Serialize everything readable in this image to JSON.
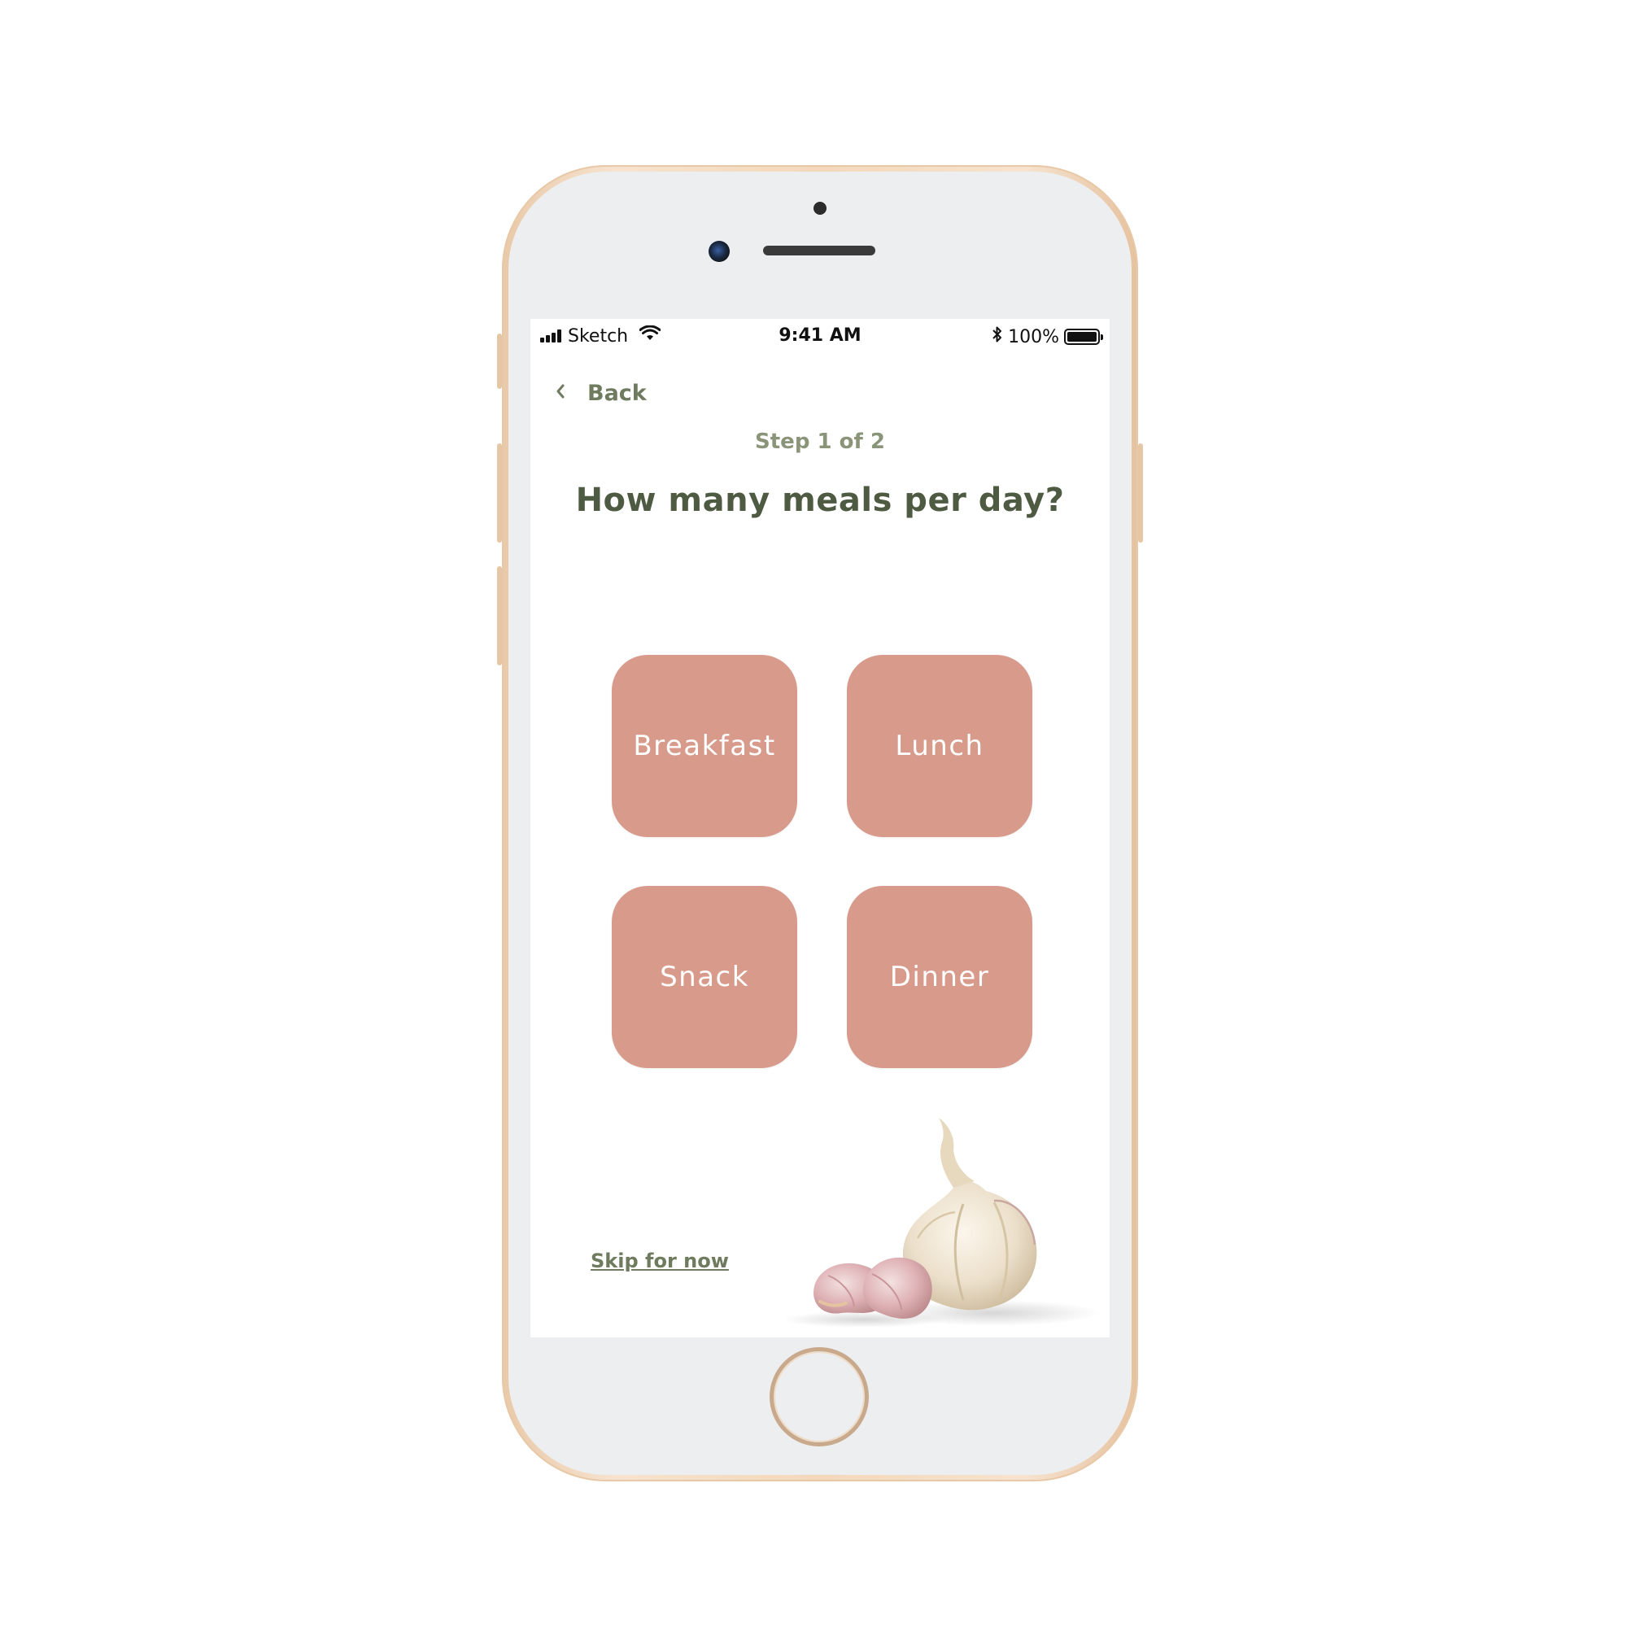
{
  "status_bar": {
    "carrier": "Sketch",
    "time": "9:41 AM",
    "battery": "100%",
    "icons": [
      "signal-icon",
      "wifi-icon",
      "bluetooth-icon",
      "battery-icon"
    ]
  },
  "nav": {
    "back_label": "Back",
    "back_icon": "chevron-left-icon"
  },
  "header": {
    "step": "Step 1 of 2",
    "question": "How many meals per day?"
  },
  "options": [
    {
      "label": "Breakfast"
    },
    {
      "label": "Lunch"
    },
    {
      "label": "Snack"
    },
    {
      "label": "Dinner"
    }
  ],
  "footer": {
    "skip_label": "Skip for now"
  },
  "colors": {
    "accent_green": "#6f7b5e",
    "heading_green": "#4f5a42",
    "option_fill": "#d89a8a",
    "phone_gold": "#f3d8bb"
  },
  "decoration": {
    "image_subject": "garlic-image"
  }
}
